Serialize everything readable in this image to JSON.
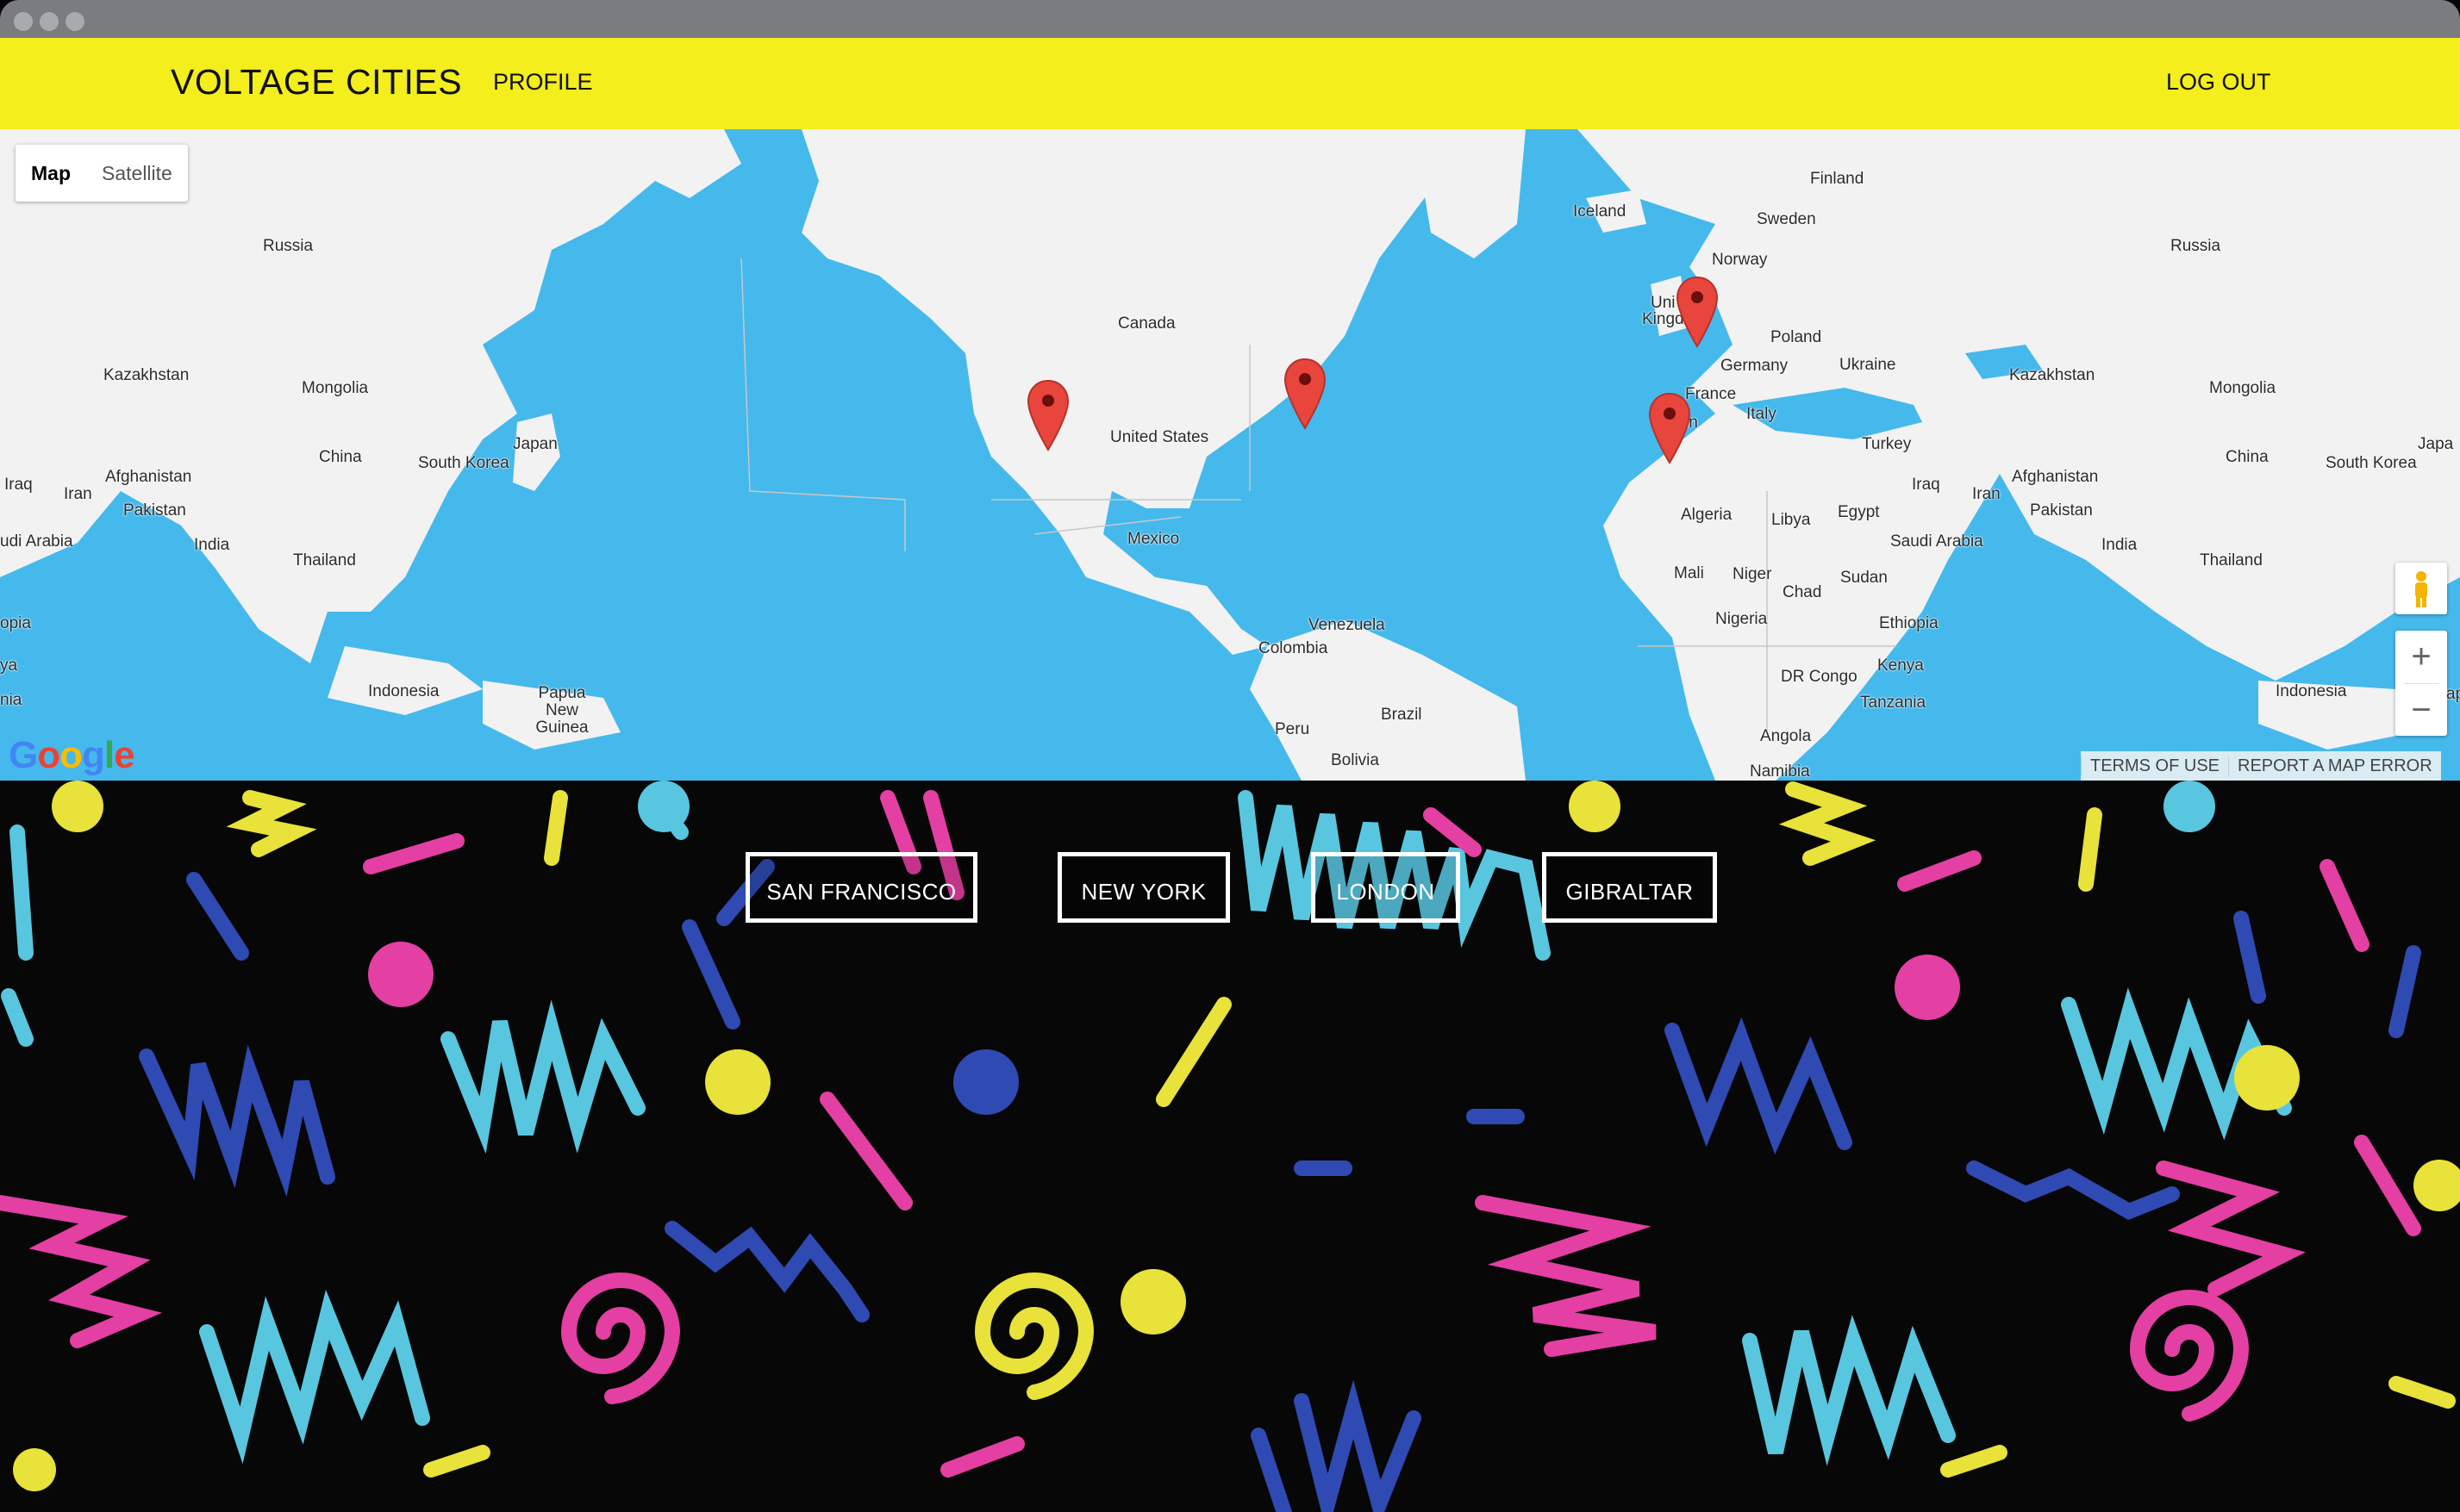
{
  "app": {
    "brand": "VOLTAGE CITIES",
    "nav_profile": "PROFILE",
    "nav_logout": "LOG OUT",
    "nav_color": "#f3ee1c"
  },
  "map": {
    "type_controls": [
      "Map",
      "Satellite"
    ],
    "active_type": "Map",
    "ocean_color": "#45b9ec",
    "land_color": "#f2f2f2",
    "marker_color": "#e8453c",
    "labels": [
      "Russia",
      "Kazakhstan",
      "Mongolia",
      "China",
      "South Korea",
      "Japan",
      "Afghanistan",
      "Iraq",
      "Iran",
      "Pakistan",
      "India",
      "udi Arabia",
      "Thailand",
      "opia",
      "ya",
      "nia",
      "Indonesia",
      "Papua New Guinea",
      "Canada",
      "United States",
      "Mexico",
      "Venezuela",
      "Colombia",
      "Brazil",
      "Peru",
      "Bolivia",
      "Iceland",
      "Finland",
      "Sweden",
      "Norway",
      "Uni",
      "Kingd",
      "Poland",
      "Germany",
      "Ukraine",
      "France",
      "Italy",
      "in",
      "Turkey",
      "Algeria",
      "Libya",
      "Egypt",
      "Mali",
      "Niger",
      "Chad",
      "Sudan",
      "Nigeria",
      "Ethiopia",
      "DR Congo",
      "Kenya",
      "Tanzania",
      "Angola",
      "Namibia",
      "Russia",
      "Kazakhstan",
      "Mongolia",
      "Iraq",
      "Iran",
      "Afghanistan",
      "Pakistan",
      "Saudi Arabia",
      "China",
      "India",
      "South Korea",
      "Japa",
      "Thailand",
      "Indonesia",
      "ap"
    ],
    "footer": [
      "TERMS OF USE",
      "REPORT A MAP ERROR"
    ],
    "logo": "Google",
    "zoom_in": "+",
    "zoom_out": "−"
  },
  "cities": [
    "SAN FRANCISCO",
    "NEW YORK",
    "LONDON",
    "GIBRALTAR"
  ]
}
